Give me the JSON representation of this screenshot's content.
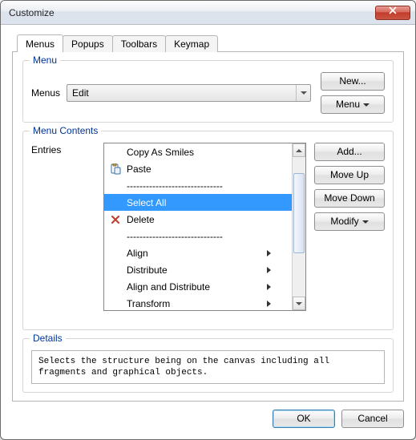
{
  "window": {
    "title": "Customize"
  },
  "tabs": {
    "items": [
      {
        "label": "Menus",
        "active": true
      },
      {
        "label": "Popups",
        "active": false
      },
      {
        "label": "Toolbars",
        "active": false
      },
      {
        "label": "Keymap",
        "active": false
      }
    ]
  },
  "menu_section": {
    "legend": "Menu",
    "label": "Menus",
    "selected": "Edit",
    "buttons": {
      "new": "New...",
      "menu": "Menu"
    }
  },
  "contents_section": {
    "legend": "Menu Contents",
    "label": "Entries",
    "buttons": {
      "add": "Add...",
      "move_up": "Move Up",
      "move_down": "Move Down",
      "modify": "Modify"
    },
    "entries": [
      {
        "text": "Copy As Smiles",
        "icon": "none",
        "submenu": false,
        "selected": false,
        "separator": false
      },
      {
        "text": "Paste",
        "icon": "paste",
        "submenu": false,
        "selected": false,
        "separator": false
      },
      {
        "text": "------------------------------",
        "icon": "none",
        "submenu": false,
        "selected": false,
        "separator": true
      },
      {
        "text": "Select All",
        "icon": "none",
        "submenu": false,
        "selected": true,
        "separator": false
      },
      {
        "text": "Delete",
        "icon": "delete",
        "submenu": false,
        "selected": false,
        "separator": false
      },
      {
        "text": "------------------------------",
        "icon": "none",
        "submenu": false,
        "selected": false,
        "separator": true
      },
      {
        "text": "Align",
        "icon": "none",
        "submenu": true,
        "selected": false,
        "separator": false
      },
      {
        "text": "Distribute",
        "icon": "none",
        "submenu": true,
        "selected": false,
        "separator": false
      },
      {
        "text": "Align and Distribute",
        "icon": "none",
        "submenu": true,
        "selected": false,
        "separator": false
      },
      {
        "text": "Transform",
        "icon": "none",
        "submenu": true,
        "selected": false,
        "separator": false
      }
    ]
  },
  "details_section": {
    "legend": "Details",
    "text": "Selects the structure being on the canvas including all fragments and graphical objects."
  },
  "footer": {
    "ok": "OK",
    "cancel": "Cancel"
  }
}
